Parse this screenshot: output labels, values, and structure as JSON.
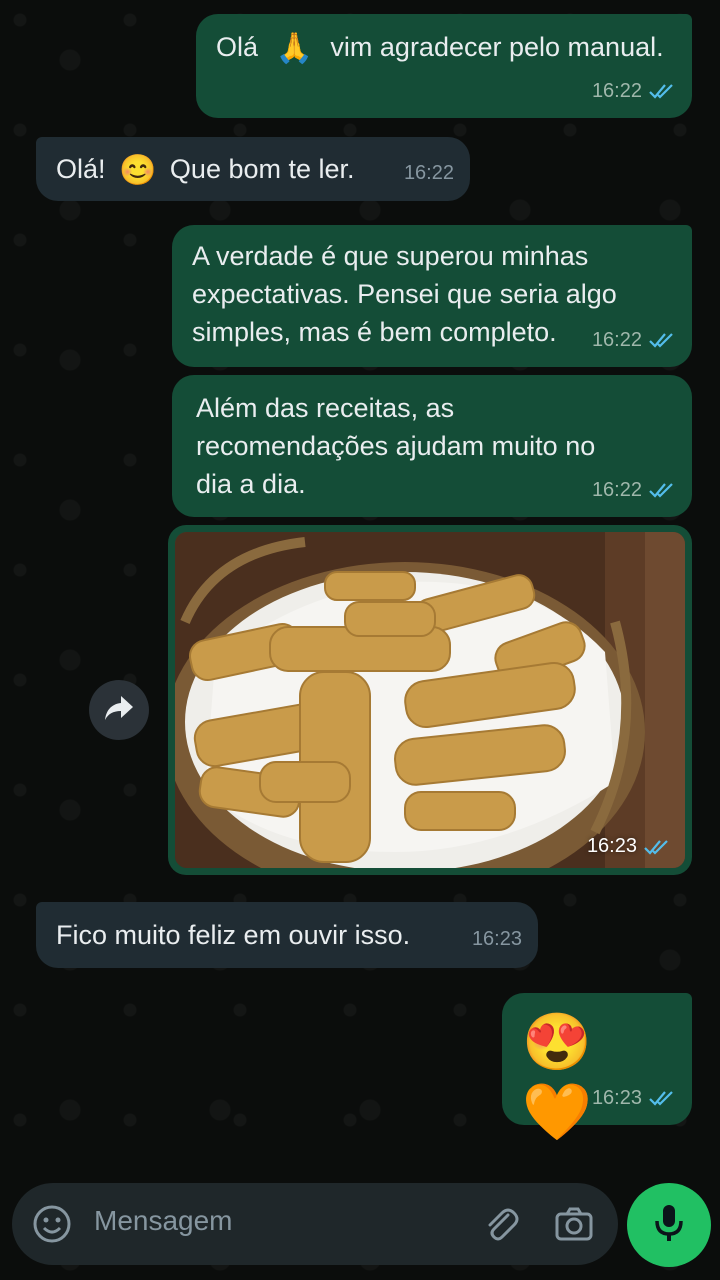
{
  "messages": [
    {
      "direction": "outgoing",
      "text_before": "Olá",
      "emoji": "🙏",
      "text_after": "vim agradecer pelo manual.",
      "time": "16:22",
      "status": "read"
    },
    {
      "direction": "incoming",
      "text_before": "Olá!",
      "emoji": "😊",
      "text_after": "Que bom te ler.",
      "time": "16:22"
    },
    {
      "direction": "outgoing",
      "text": "A verdade é que superou minhas expectativas. Pensei que seria algo simples, mas é bem completo.",
      "time": "16:22",
      "status": "read"
    },
    {
      "direction": "outgoing",
      "text": "Além das receitas, as recomendações ajudam muito no dia a dia.",
      "time": "16:22",
      "status": "read"
    },
    {
      "direction": "outgoing",
      "type": "image",
      "image": "dog-bone-biscuits-in-basket",
      "time": "16:23",
      "status": "read"
    },
    {
      "direction": "incoming",
      "text": "Fico muito feliz em ouvir isso.",
      "time": "16:23"
    },
    {
      "direction": "outgoing",
      "emojis": "😍 🧡",
      "time": "16:23",
      "status": "read"
    }
  ],
  "composer": {
    "placeholder": "Mensagem",
    "icons": [
      "emoji-icon",
      "attach-icon",
      "camera-icon",
      "mic-icon"
    ]
  },
  "colors": {
    "outgoing_bubble": "#144d37",
    "incoming_bubble": "#202c33",
    "read_ticks": "#53bdeb",
    "mic_button": "#21c063"
  }
}
